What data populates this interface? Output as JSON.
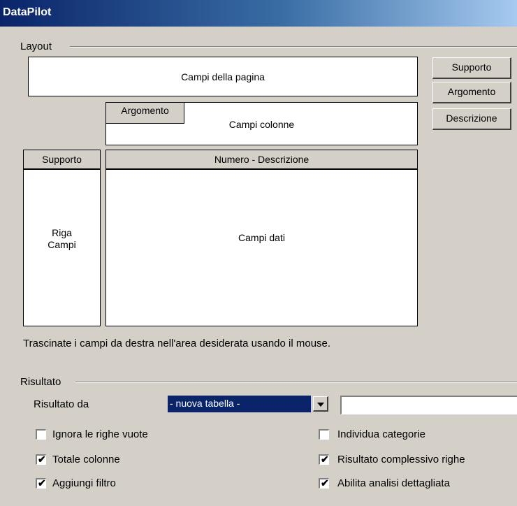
{
  "window": {
    "title": "DataPilot"
  },
  "layout": {
    "group_label": "Layout",
    "page_fields": "Campi della pagina",
    "column_fields": "Campi colonne",
    "column_field_button": "Argomento",
    "row_header": "Supporto",
    "row_fields_line1": "Riga",
    "row_fields_line2": "Campi",
    "data_header": "Numero - Descrizione",
    "data_fields": "Campi dati",
    "hint": "Trascinate i campi da destra nell'area desiderata usando il mouse."
  },
  "available_fields": [
    "Supporto",
    "Argomento",
    "Descrizione"
  ],
  "result": {
    "group_label": "Risultato",
    "output_label": "Risultato da",
    "output_value": "- nuova tabella -",
    "output_text": ""
  },
  "options": [
    {
      "label": "Ignora le righe vuote",
      "checked": false
    },
    {
      "label": "Individua categorie",
      "checked": false
    },
    {
      "label": "Totale colonne",
      "checked": true
    },
    {
      "label": "Risultato complessivo righe",
      "checked": true
    },
    {
      "label": "Aggiungi filtro",
      "checked": true
    },
    {
      "label": "Abilita analisi dettagliata",
      "checked": true
    }
  ]
}
